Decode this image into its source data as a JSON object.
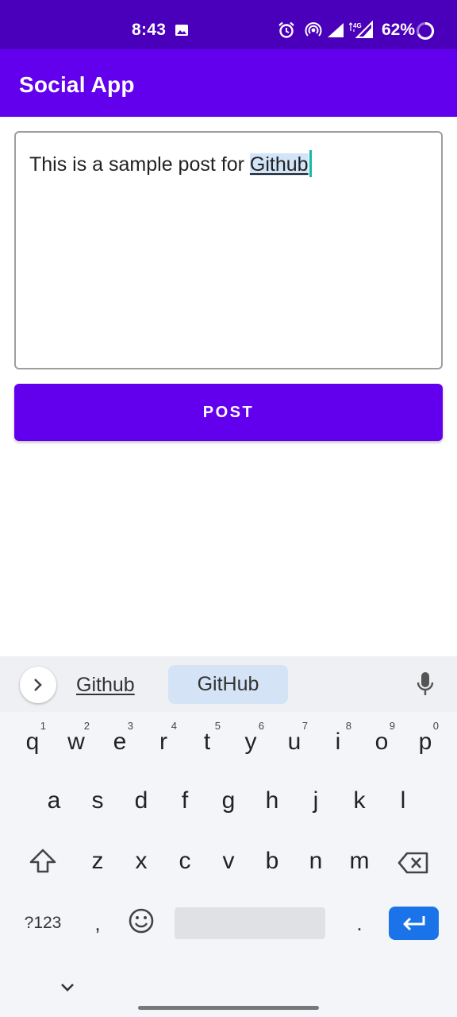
{
  "status_bar": {
    "time": "8:43",
    "battery": "62%",
    "icons": [
      "image-icon",
      "alarm-icon",
      "hotspot-icon",
      "signal-icon",
      "signal-4g-icon",
      "battery-charging-icon"
    ]
  },
  "app_bar": {
    "title": "Social App"
  },
  "post_input": {
    "text": "This is a sample post for ",
    "composing_word": "Github"
  },
  "post_button": {
    "label": "POST"
  },
  "keyboard": {
    "suggestions": [
      "Github",
      "GitHub"
    ],
    "row1": [
      {
        "key": "q",
        "hint": "1"
      },
      {
        "key": "w",
        "hint": "2"
      },
      {
        "key": "e",
        "hint": "3"
      },
      {
        "key": "r",
        "hint": "4"
      },
      {
        "key": "t",
        "hint": "5"
      },
      {
        "key": "y",
        "hint": "6"
      },
      {
        "key": "u",
        "hint": "7"
      },
      {
        "key": "i",
        "hint": "8"
      },
      {
        "key": "o",
        "hint": "9"
      },
      {
        "key": "p",
        "hint": "0"
      }
    ],
    "row2": [
      "a",
      "s",
      "d",
      "f",
      "g",
      "h",
      "j",
      "k",
      "l"
    ],
    "row3": [
      "z",
      "x",
      "c",
      "v",
      "b",
      "n",
      "m"
    ],
    "symbols_label": "?123",
    "comma": ",",
    "period": ".",
    "emoji": "☺"
  },
  "colors": {
    "status_bar": "#4a00bb",
    "primary": "#6200ee",
    "accent": "#1a73e8"
  }
}
